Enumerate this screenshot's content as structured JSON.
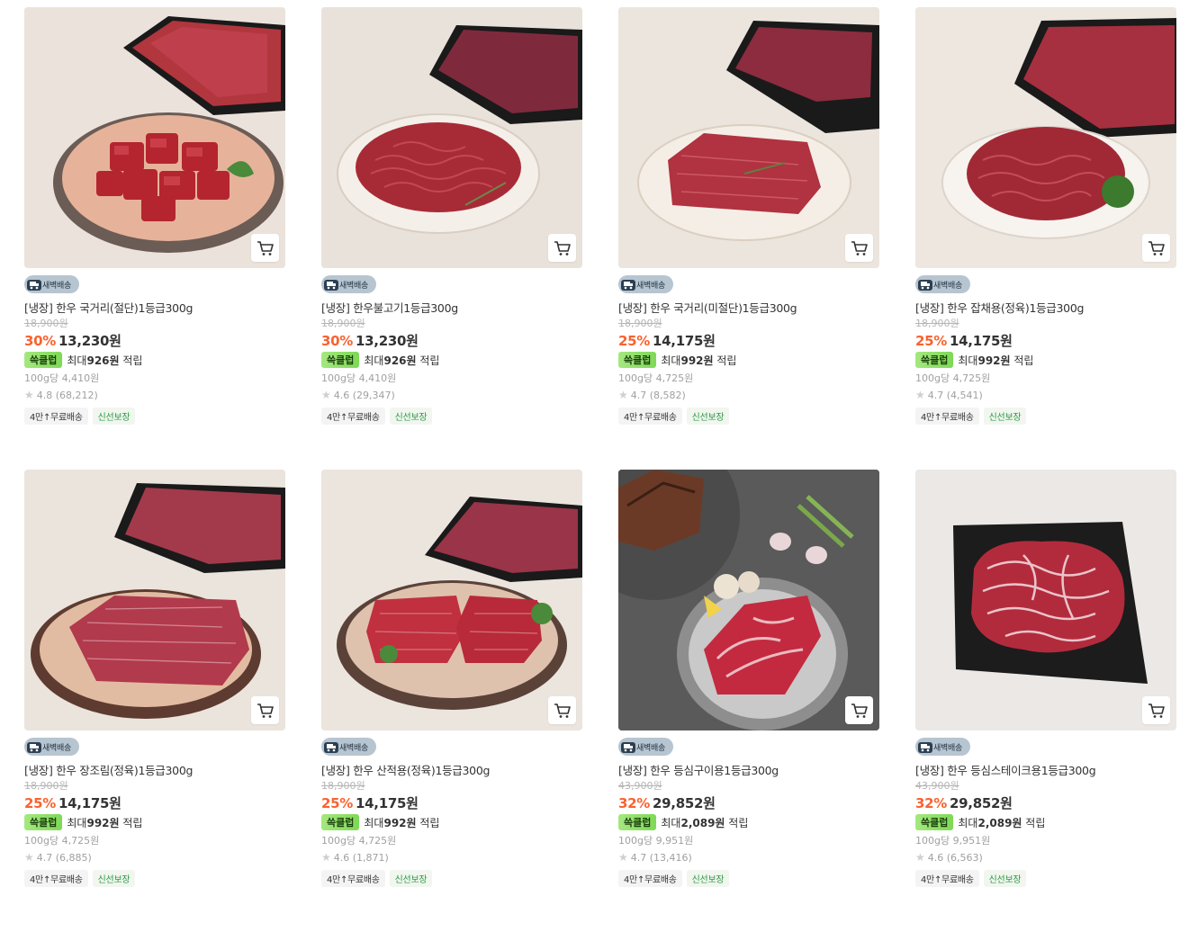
{
  "products": [
    {
      "delivery_badge": "새벽배송",
      "name": "[냉장] 한우 국거리(절단)1등급300g",
      "original_price": "18,900원",
      "discount": "30%",
      "price": "13,230원",
      "club_label": "쓱클럽",
      "club_prefix": "최대",
      "club_amount": "926원",
      "club_suffix": "적립",
      "unit_price": "100g당 4,410원",
      "rating": "4.8",
      "reviews": "(68,212)",
      "tag_shipping": "4만↑무료배송",
      "tag_fresh": "신선보장",
      "image_desc": "cubed-beef",
      "cart_icon": "cart-icon"
    },
    {
      "delivery_badge": "새벽배송",
      "name": "[냉장] 한우불고기1등급300g",
      "original_price": "18,900원",
      "discount": "30%",
      "price": "13,230원",
      "club_label": "쓱클럽",
      "club_prefix": "최대",
      "club_amount": "926원",
      "club_suffix": "적립",
      "unit_price": "100g당 4,410원",
      "rating": "4.6",
      "reviews": "(29,347)",
      "tag_shipping": "4만↑무료배송",
      "tag_fresh": "신선보장",
      "image_desc": "bulgogi-beef",
      "cart_icon": "cart-icon"
    },
    {
      "delivery_badge": "새벽배송",
      "name": "[냉장] 한우 국거리(미절단)1등급300g",
      "original_price": "18,900원",
      "discount": "25%",
      "price": "14,175원",
      "club_label": "쓱클럽",
      "club_prefix": "최대",
      "club_amount": "992원",
      "club_suffix": "적립",
      "unit_price": "100g당 4,725원",
      "rating": "4.7",
      "reviews": "(8,582)",
      "tag_shipping": "4만↑무료배송",
      "tag_fresh": "신선보장",
      "image_desc": "uncut-beef",
      "cart_icon": "cart-icon"
    },
    {
      "delivery_badge": "새벽배송",
      "name": "[냉장] 한우 잡채용(정육)1등급300g",
      "original_price": "18,900원",
      "discount": "25%",
      "price": "14,175원",
      "club_label": "쓱클럽",
      "club_prefix": "최대",
      "club_amount": "992원",
      "club_suffix": "적립",
      "unit_price": "100g당 4,725원",
      "rating": "4.7",
      "reviews": "(4,541)",
      "tag_shipping": "4만↑무료배송",
      "tag_fresh": "신선보장",
      "image_desc": "japchae-beef",
      "cart_icon": "cart-icon"
    },
    {
      "delivery_badge": "새벽배송",
      "name": "[냉장] 한우 장조림(정육)1등급300g",
      "original_price": "18,900원",
      "discount": "25%",
      "price": "14,175원",
      "club_label": "쓱클럽",
      "club_prefix": "최대",
      "club_amount": "992원",
      "club_suffix": "적립",
      "unit_price": "100g당 4,725원",
      "rating": "4.7",
      "reviews": "(6,885)",
      "tag_shipping": "4만↑무료배송",
      "tag_fresh": "신선보장",
      "image_desc": "jangjorim-beef",
      "cart_icon": "cart-icon"
    },
    {
      "delivery_badge": "새벽배송",
      "name": "[냉장] 한우 산적용(정육)1등급300g",
      "original_price": "18,900원",
      "discount": "25%",
      "price": "14,175원",
      "club_label": "쓱클럽",
      "club_prefix": "최대",
      "club_amount": "992원",
      "club_suffix": "적립",
      "unit_price": "100g당 4,725원",
      "rating": "4.6",
      "reviews": "(1,871)",
      "tag_shipping": "4만↑무료배송",
      "tag_fresh": "신선보장",
      "image_desc": "sanjeok-beef",
      "cart_icon": "cart-icon"
    },
    {
      "delivery_badge": "새벽배송",
      "name": "[냉장] 한우 등심구이용1등급300g",
      "original_price": "43,900원",
      "discount": "32%",
      "price": "29,852원",
      "club_label": "쓱클럽",
      "club_prefix": "최대",
      "club_amount": "2,089원",
      "club_suffix": "적립",
      "unit_price": "100g당 9,951원",
      "rating": "4.7",
      "reviews": "(13,416)",
      "tag_shipping": "4만↑무료배송",
      "tag_fresh": "신선보장",
      "image_desc": "sirloin-grill-beef",
      "cart_icon": "cart-icon"
    },
    {
      "delivery_badge": "새벽배송",
      "name": "[냉장] 한우 등심스테이크용1등급300g",
      "original_price": "43,900원",
      "discount": "32%",
      "price": "29,852원",
      "club_label": "쓱클럽",
      "club_prefix": "최대",
      "club_amount": "2,089원",
      "club_suffix": "적립",
      "unit_price": "100g당 9,951원",
      "rating": "4.6",
      "reviews": "(6,563)",
      "tag_shipping": "4만↑무료배송",
      "tag_fresh": "신선보장",
      "image_desc": "sirloin-steak-beef",
      "cart_icon": "cart-icon"
    }
  ],
  "colors": {
    "discount": "#fa622f",
    "club_badge": "#8ee06c",
    "fresh_tag": "#2c9a45",
    "dawn_badge": "#b7c5d1"
  }
}
